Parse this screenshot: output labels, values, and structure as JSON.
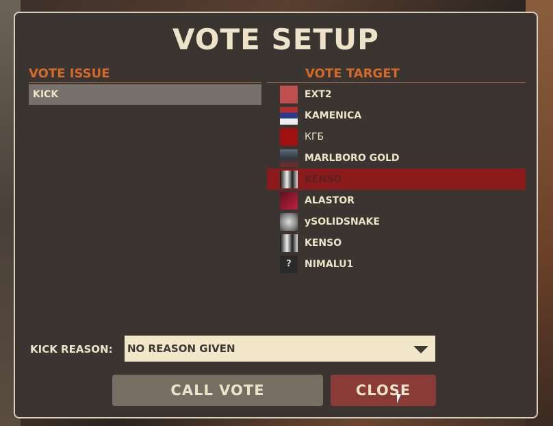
{
  "title": "VOTE SETUP",
  "vote_issue": {
    "header": "VOTE ISSUE",
    "items": [
      {
        "label": "KICK"
      }
    ]
  },
  "vote_target": {
    "header": "VOTE TARGET",
    "players": [
      {
        "name": "EXT2",
        "avatar_color": "#c05050",
        "avatar_icon": "stop-avatar-icon"
      },
      {
        "name": "KAMENICA",
        "avatar_color": "#b03030",
        "avatar_icon": "flag-avatar-icon"
      },
      {
        "name": "КГБ",
        "avatar_color": "#a01010",
        "avatar_icon": "kgb-avatar-icon"
      },
      {
        "name": "MARLBORO GOLD",
        "avatar_color": "#404850",
        "avatar_icon": "portrait-avatar-icon"
      },
      {
        "name": "KENSO",
        "avatar_color": "#dddddd",
        "avatar_icon": "anime-avatar-icon",
        "selected": true
      },
      {
        "name": "ALASTOR",
        "avatar_color": "#b01830",
        "avatar_icon": "demon-avatar-icon"
      },
      {
        "name": "ySOLIDSNAKE",
        "avatar_color": "#999999",
        "avatar_icon": "face-avatar-icon"
      },
      {
        "name": "KENSO",
        "avatar_color": "#dddddd",
        "avatar_icon": "anime-avatar-icon"
      },
      {
        "name": "NIMALU1",
        "avatar_color": "#2a2a2a",
        "avatar_icon": "question-avatar-icon",
        "avatar_text": "?"
      }
    ]
  },
  "kick_reason": {
    "label": "KICK REASON:",
    "selected": "NO REASON GIVEN"
  },
  "buttons": {
    "call_vote": "CALL VOTE",
    "close": "CLOSE"
  },
  "colors": {
    "accent_orange": "#d4692a",
    "selected_row": "#8b1a1a",
    "panel_bg": "#3a3531",
    "text_cream": "#ede3c8",
    "close_button": "#8b3b37",
    "call_button": "#776e63"
  }
}
